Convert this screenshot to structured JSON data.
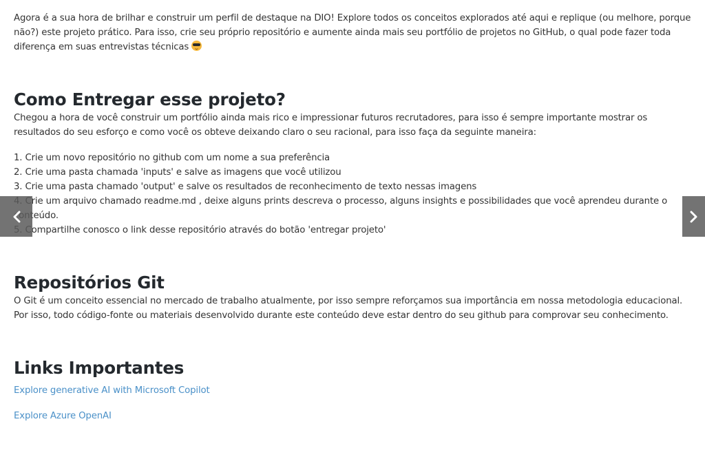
{
  "intro": {
    "text": "Agora é a sua hora de brilhar e construir um perfil de destaque na DIO! Explore todos os conceitos explorados até aqui e replique (ou melhore, porque não?) este projeto prático. Para isso, crie seu próprio repositório e aumente ainda mais seu portfólio de projetos no GitHub, o qual pode fazer toda diferença em suas entrevistas técnicas",
    "emoji_icon": "sunglasses-emoji-icon"
  },
  "entregar": {
    "heading": "Como Entregar esse projeto?",
    "text": "Chegou a hora de você construir um portfólio ainda mais rico e impressionar futuros recrutadores, para isso é sempre importante mostrar os resultados do seu esforço e como você os obteve deixando claro o seu racional, para isso faça da seguinte maneira:",
    "steps": [
      "1. Crie um novo repositório no github com um nome a sua preferência",
      "2. Crie uma pasta chamada 'inputs' e salve as imagens que você utilizou",
      "3. Crie uma pasta chamado 'output' e salve os resultados de reconhecimento de texto nessas imagens",
      "4. Crie um arquivo chamado readme.md , deixe alguns prints descreva o processo, alguns insights e possibilidades que você aprendeu durante o conteúdo.",
      "5. Compartilhe conosco o link desse repositório através do botão 'entregar projeto'"
    ]
  },
  "repos": {
    "heading": "Repositórios Git",
    "text": "O Git é um conceito essencial no mercado de trabalho atualmente, por isso sempre reforçamos sua importância em nossa metodologia educacional. Por isso, todo código-fonte ou materiais desenvolvido durante este conteúdo deve estar dentro do seu github para comprovar seu conhecimento."
  },
  "links": {
    "heading": "Links Importantes",
    "items": [
      "Explore generative AI with Microsoft Copilot",
      "Explore Azure OpenAI"
    ]
  },
  "nav": {
    "prev_icon": "chevron-left-icon",
    "next_icon": "chevron-right-icon"
  },
  "colors": {
    "text": "#333333",
    "heading": "#24292e",
    "link": "#4a90c8",
    "nav_bg": "#5a5a5a"
  }
}
